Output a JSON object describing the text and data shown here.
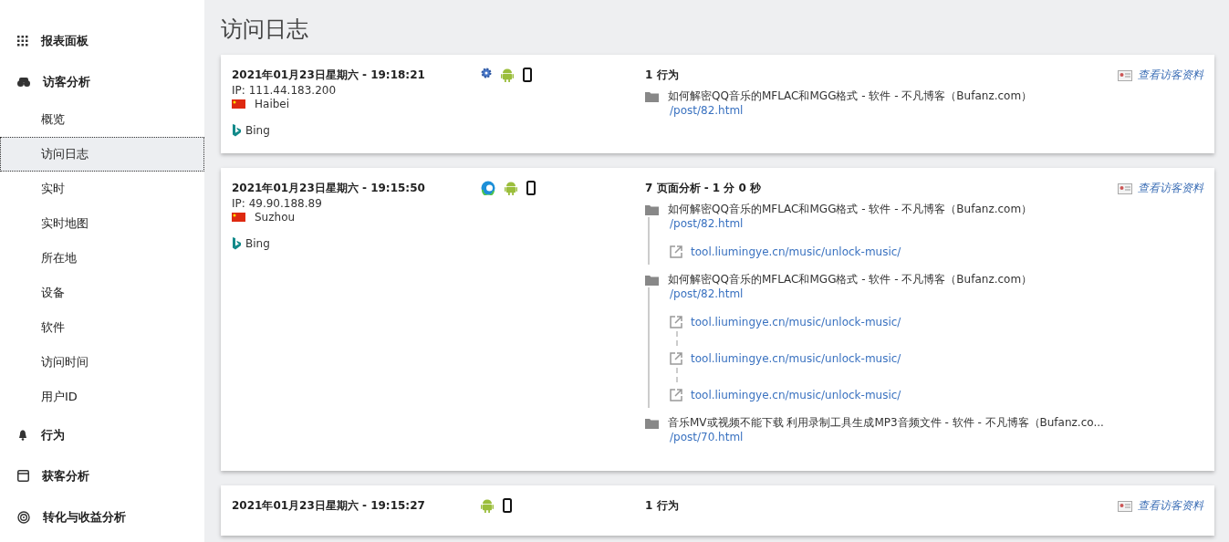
{
  "sidebar": {
    "items": [
      {
        "kind": "section",
        "label": "报表面板",
        "selected": false
      },
      {
        "kind": "section",
        "label": "访客分析",
        "selected": false
      },
      {
        "kind": "sub",
        "label": "概览",
        "selected": false
      },
      {
        "kind": "sub",
        "label": "访问日志",
        "selected": true
      },
      {
        "kind": "sub",
        "label": "实时",
        "selected": false
      },
      {
        "kind": "sub",
        "label": "实时地图",
        "selected": false
      },
      {
        "kind": "sub",
        "label": "所在地",
        "selected": false
      },
      {
        "kind": "sub",
        "label": "设备",
        "selected": false
      },
      {
        "kind": "sub",
        "label": "软件",
        "selected": false
      },
      {
        "kind": "sub",
        "label": "访问时间",
        "selected": false
      },
      {
        "kind": "sub",
        "label": "用户ID",
        "selected": false
      },
      {
        "kind": "section",
        "label": "行为",
        "selected": false
      },
      {
        "kind": "section",
        "label": "获客分析",
        "selected": false
      },
      {
        "kind": "section",
        "label": "转化与收益分析",
        "selected": false
      }
    ]
  },
  "page_title": "访问日志",
  "visits": [
    {
      "datetime": "2021年01月23日星期六 - 19:18:21",
      "ip": "IP: 111.44.183.200",
      "city": "Haibei",
      "referrer": "Bing",
      "icons": [
        {
          "kind": "gear"
        },
        {
          "kind": "android"
        },
        {
          "kind": "phone"
        }
      ],
      "summary": "1 行为",
      "profile_link": "查看访客资料",
      "actions": [
        {
          "title": "如何解密QQ音乐的MFLAC和MGG格式 - 软件 - 不凡博客（Bufanz.com）",
          "path": "/post/82.html"
        }
      ]
    },
    {
      "datetime": "2021年01月23日星期六 - 19:15:50",
      "ip": "IP: 49.90.188.89",
      "city": "Suzhou",
      "referrer": "Bing",
      "icons": [
        {
          "kind": "edge"
        },
        {
          "kind": "android"
        },
        {
          "kind": "phone"
        }
      ],
      "summary": "7 页面分析 - 1 分 0 秒",
      "profile_link": "查看访客资料",
      "actions": [
        {
          "title": "如何解密QQ音乐的MFLAC和MGG格式 - 软件 - 不凡博客（Bufanz.com）",
          "path": "/post/82.html",
          "outlinks": [
            "tool.liumingye.cn/music/unlock-music/"
          ]
        },
        {
          "title": "如何解密QQ音乐的MFLAC和MGG格式 - 软件 - 不凡博客（Bufanz.com）",
          "path": "/post/82.html",
          "outlinks": [
            "tool.liumingye.cn/music/unlock-music/",
            "tool.liumingye.cn/music/unlock-music/",
            "tool.liumingye.cn/music/unlock-music/"
          ]
        },
        {
          "title": "音乐MV或视频不能下载 利用录制工具生成MP3音频文件 - 软件 - 不凡博客（Bufanz.co...",
          "path": "/post/70.html"
        }
      ]
    },
    {
      "datetime": "2021年01月23日星期六 - 19:15:27",
      "icons": [
        {
          "kind": "android"
        },
        {
          "kind": "phone"
        }
      ],
      "summary": "1 行为",
      "profile_link": "查看访客资料"
    }
  ]
}
